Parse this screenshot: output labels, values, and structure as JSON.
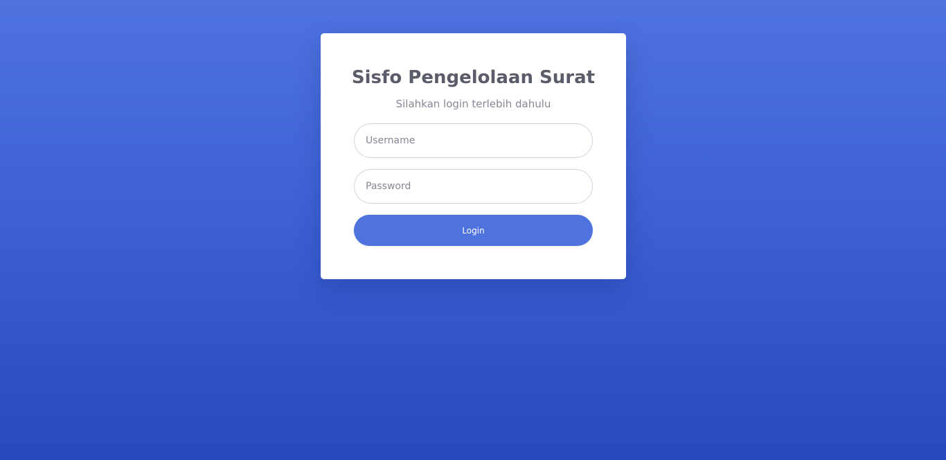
{
  "login": {
    "title": "Sisfo Pengelolaan Surat",
    "subtitle": "Silahkan login terlebih dahulu",
    "username_placeholder": "Username",
    "password_placeholder": "Password",
    "login_label": "Login"
  },
  "colors": {
    "accent": "#4e73df",
    "background_top": "#4e73df",
    "background_bottom": "#2748bf",
    "card": "#ffffff",
    "title_text": "#5a5c69",
    "muted_text": "#858796"
  }
}
